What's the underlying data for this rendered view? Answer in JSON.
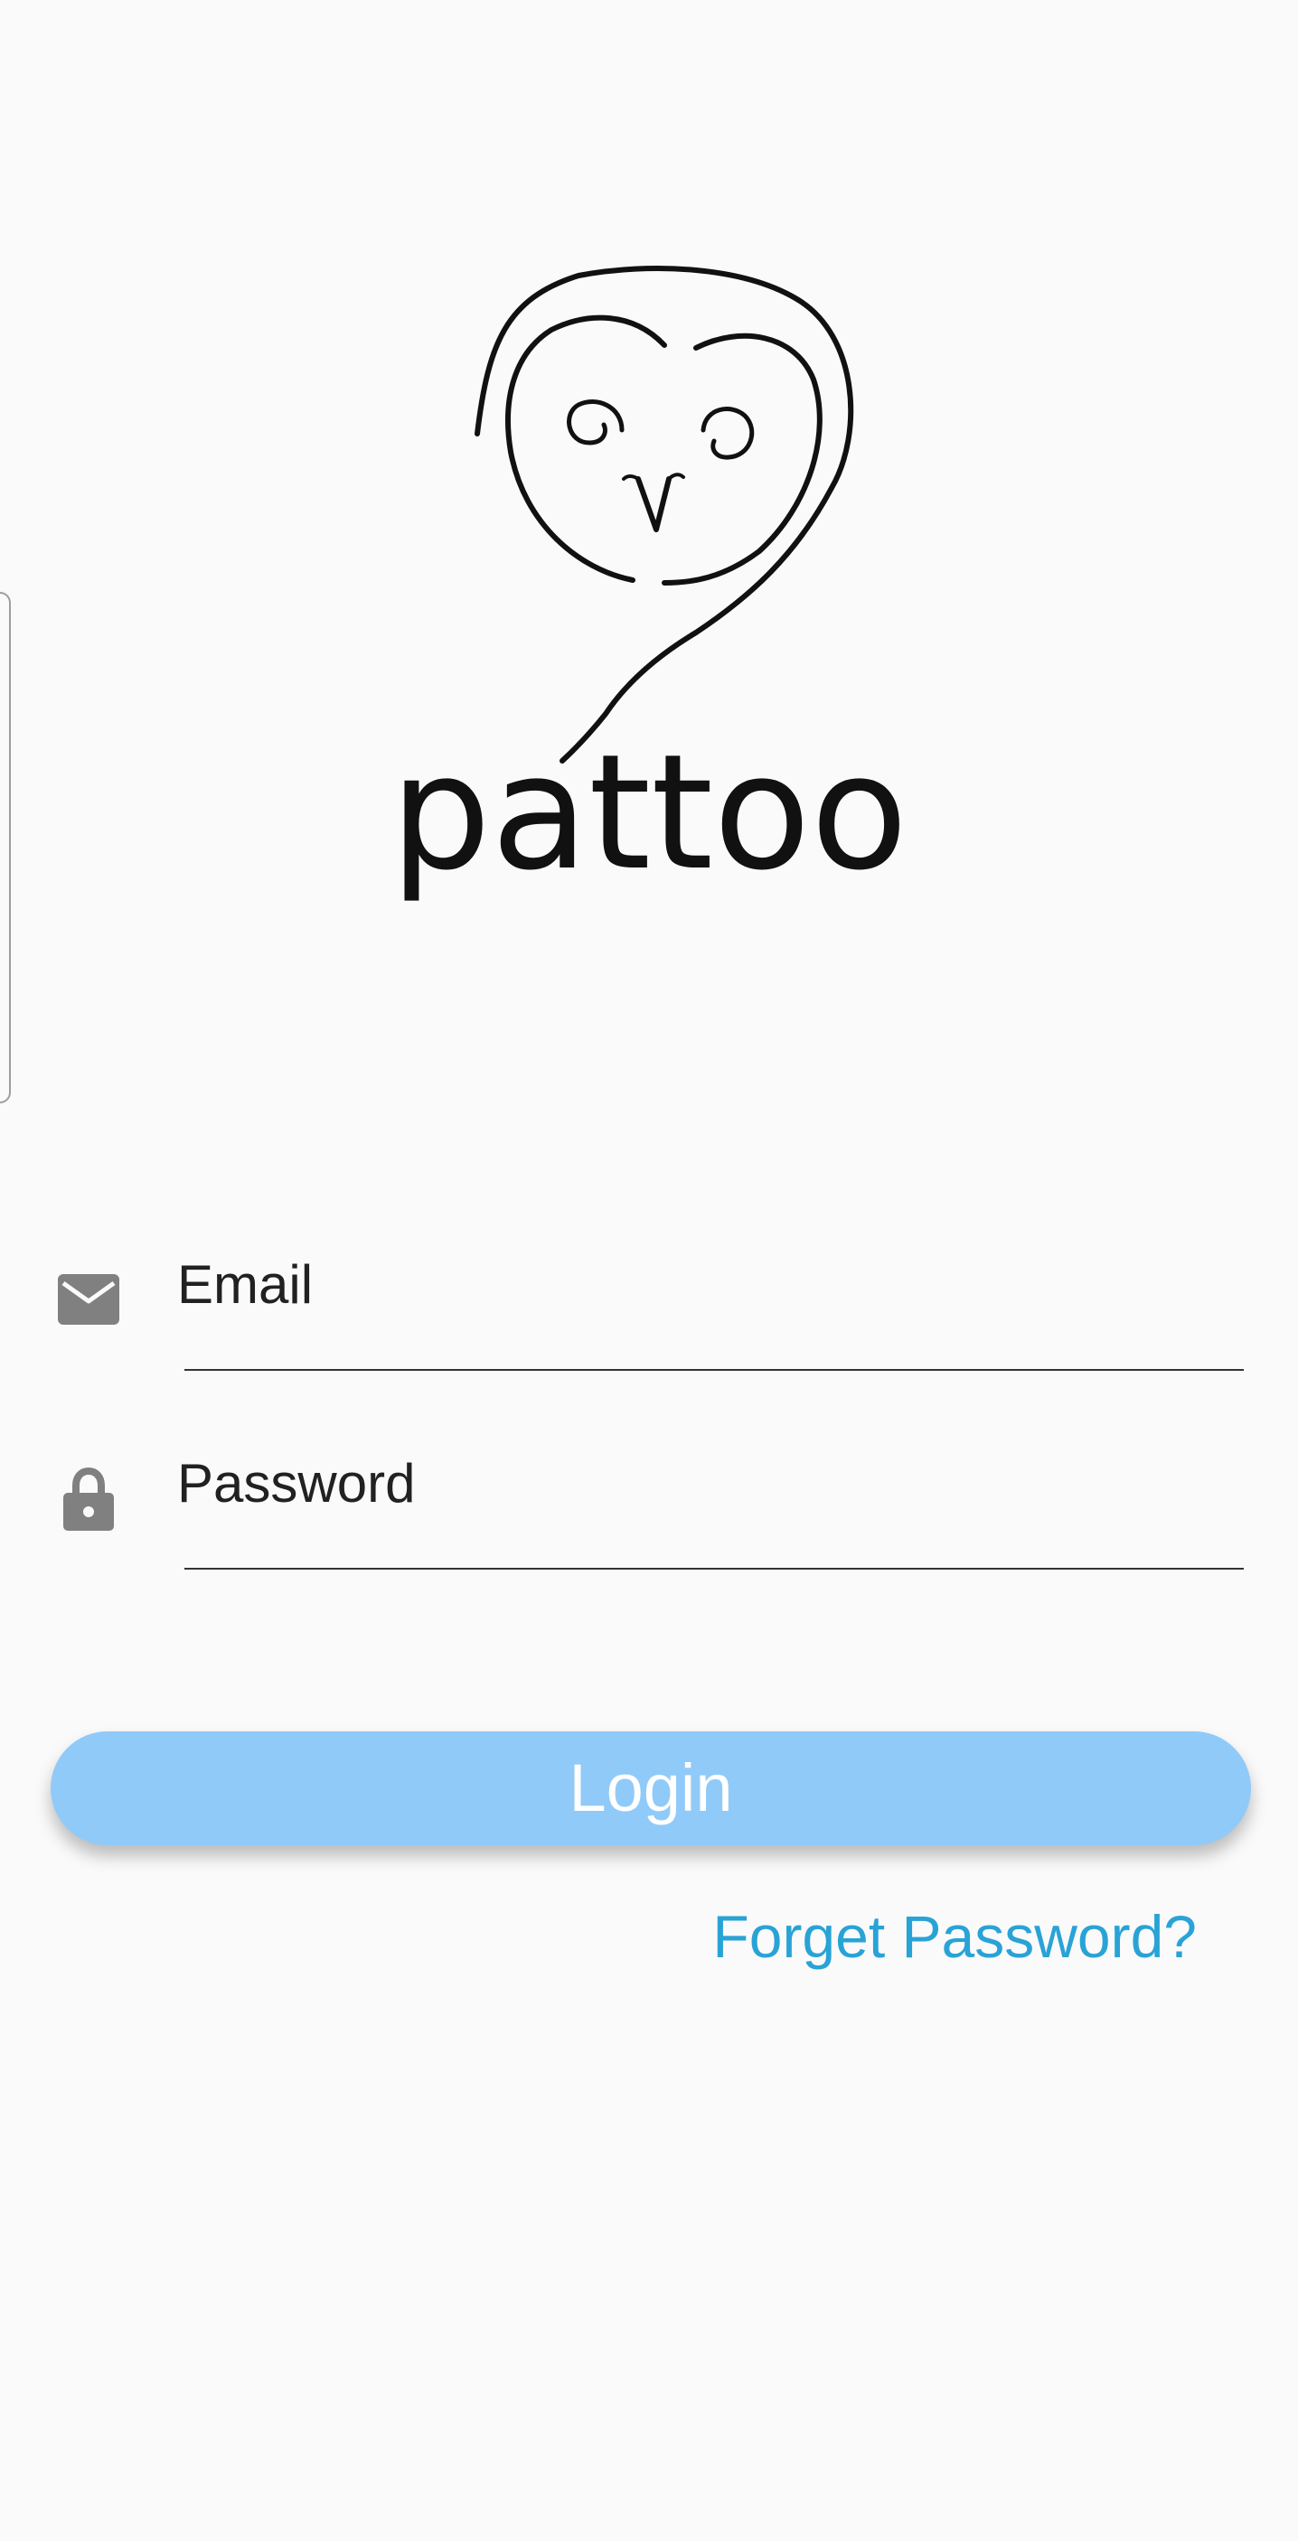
{
  "brand": {
    "name": "pattoo",
    "logo_icon": "owl-logo-icon"
  },
  "email": {
    "icon": "envelope-icon",
    "label": "Email"
  },
  "password": {
    "icon": "lock-icon",
    "label": "Password"
  },
  "login": {
    "label": "Login"
  },
  "forgot": {
    "label": "Forget Password?"
  },
  "colors": {
    "background": "#fafafa",
    "button": "#90caf9",
    "link": "#29a3d6",
    "icon": "#808080"
  }
}
